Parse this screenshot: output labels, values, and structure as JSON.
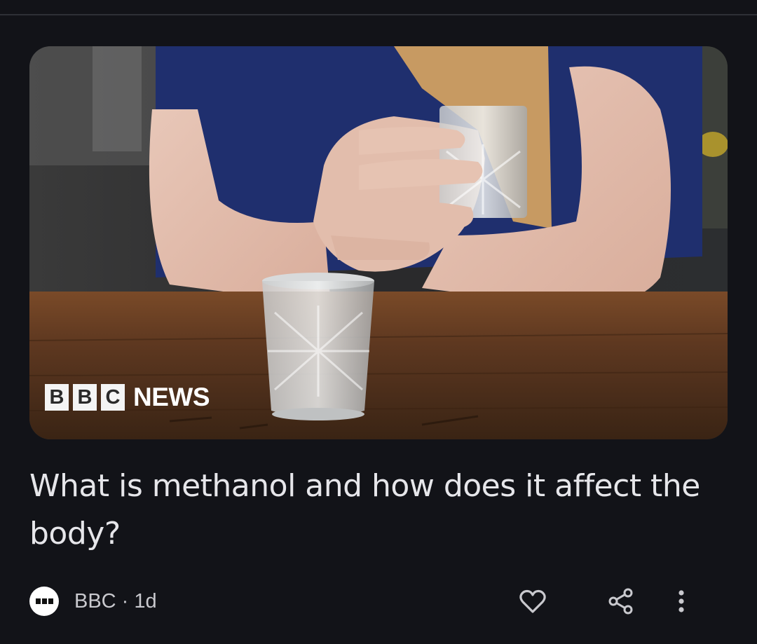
{
  "article": {
    "image": {
      "alt_brand_letters": [
        "B",
        "B",
        "C"
      ],
      "brand_suffix": "NEWS"
    },
    "headline": "What is methanol and how does it affect the body?",
    "source": "BBC",
    "separator": "·",
    "age": "1d",
    "meta_line": "BBC · 1d"
  },
  "actions": {
    "like_icon": "heart-outline-icon",
    "share_icon": "share-icon",
    "more_icon": "more-vert-icon"
  },
  "colors": {
    "background": "#121318",
    "headline": "#e6e6ea",
    "meta": "#c9c9ce"
  }
}
